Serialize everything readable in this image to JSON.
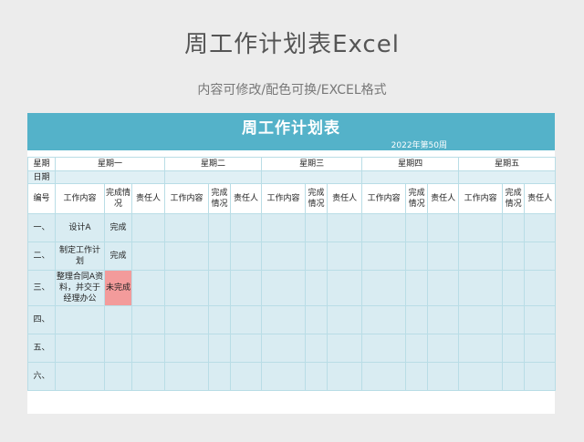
{
  "page": {
    "title": "周工作计划表Excel",
    "subtitle": "内容可修改/配色可换/EXCEL格式"
  },
  "sheet": {
    "title": "周工作计划表",
    "week": "2022年第50周",
    "day_label": "星期",
    "date_label": "日期",
    "days": [
      "星期一",
      "星期二",
      "星期三",
      "星期四",
      "星期五"
    ],
    "col_number": "编号",
    "col_content": "工作内容",
    "col_status": "完成情况",
    "col_owner": "责任人",
    "rows": [
      {
        "num": "一、",
        "content": "设计A",
        "status": "完成"
      },
      {
        "num": "二、",
        "content": "制定工作计划",
        "status": "完成"
      },
      {
        "num": "三、",
        "content": "整理合同A资料，并交于经理办公",
        "status": "未完成"
      },
      {
        "num": "四、",
        "content": "",
        "status": ""
      },
      {
        "num": "五、",
        "content": "",
        "status": ""
      },
      {
        "num": "六、",
        "content": "",
        "status": ""
      }
    ],
    "colors": {
      "header": "#54b2c9",
      "body": "#d9ecf2",
      "incomplete": "#f39b9b"
    }
  }
}
